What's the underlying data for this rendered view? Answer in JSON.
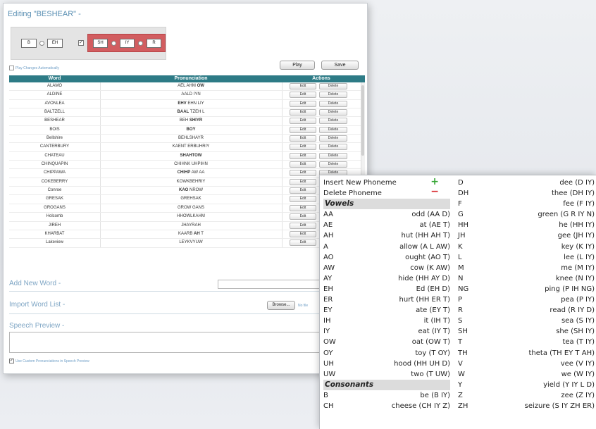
{
  "editor": {
    "title": "Editing \"BESHEAR\" -",
    "phoneme_group1": [
      "B",
      "EH"
    ],
    "phoneme_group2": [
      "SH",
      "IY",
      "R"
    ],
    "play_auto_label": "Play Changes Automatically",
    "play_button": "Play",
    "save_button": "Save",
    "table": {
      "headers": [
        "Word",
        "Pronunciation",
        "Actions"
      ],
      "edit_label": "Edit",
      "delete_label": "Delete",
      "rows": [
        {
          "word": "ALAMO",
          "pre": "AEL AHM ",
          "stress": "OW",
          "post": ""
        },
        {
          "word": "ALDINE",
          "pre": "AALD IYN",
          "stress": "",
          "post": ""
        },
        {
          "word": "AVONLEA",
          "pre": "",
          "stress": "EHV",
          "post": " EHN LIY"
        },
        {
          "word": "BALTZELL",
          "pre": "",
          "stress": "BAAL",
          "post": " TZEH L"
        },
        {
          "word": "BESHEAR",
          "pre": "BEH ",
          "stress": "SHIYR",
          "post": ""
        },
        {
          "word": "BOIS",
          "pre": "",
          "stress": "BOY",
          "post": ""
        },
        {
          "word": "Bellshire",
          "pre": "BEHLSHAYR",
          "stress": "",
          "post": ""
        },
        {
          "word": "CANTERBURY",
          "pre": "KAENT ERBUHRIY",
          "stress": "",
          "post": ""
        },
        {
          "word": "CHATEAU",
          "pre": "",
          "stress": "SHAHTOW",
          "post": ""
        },
        {
          "word": "CHINQUAPIN",
          "pre": "CHIHNK UHPIHN",
          "stress": "",
          "post": ""
        },
        {
          "word": "CHIPPAWA",
          "pre": "",
          "stress": "CHIHP",
          "post": " AW AA"
        },
        {
          "word": "COKEBERRY",
          "pre": "KOWKBEHRIY",
          "stress": "",
          "post": ""
        },
        {
          "word": "Conroe",
          "pre": "",
          "stress": "KAO",
          "post": " NROW"
        },
        {
          "word": "GRESAK",
          "pre": "GREHSAK",
          "stress": "",
          "post": ""
        },
        {
          "word": "GROGANS",
          "pre": "GROW GANS",
          "stress": "",
          "post": ""
        },
        {
          "word": "Holcomb",
          "pre": "HHOWLKAHM",
          "stress": "",
          "post": ""
        },
        {
          "word": "JIREH",
          "pre": "JHAYRAH",
          "stress": "",
          "post": ""
        },
        {
          "word": "KHARBAT",
          "pre": "KAARB ",
          "stress": "AH",
          "post": " T"
        },
        {
          "word": "Lakeview",
          "pre": "LEYKVYUW",
          "stress": "",
          "post": ""
        }
      ]
    },
    "add_new_word": "Add New Word -",
    "import_word_list": "Import Word List -",
    "browse_button": "Browse...",
    "no_file_text": "No file",
    "speech_preview": "Speech Preview -",
    "custom_pron_label": "Use Custom Pronunciations in Speech Preview"
  },
  "panel": {
    "insert_label": "Insert New Phoneme",
    "delete_label": "Delete Phoneme",
    "vowels_heading": "Vowels",
    "consonants_heading": "Consonants",
    "vowels": [
      {
        "code": "AA",
        "ex": "odd (AA D)"
      },
      {
        "code": "AE",
        "ex": "at (AE T)"
      },
      {
        "code": "AH",
        "ex": "hut (HH AH T)"
      },
      {
        "code": "A",
        "ex": "allow (A L AW)"
      },
      {
        "code": "AO",
        "ex": "ought (AO T)"
      },
      {
        "code": "AW",
        "ex": "cow (K AW)"
      },
      {
        "code": "AY",
        "ex": "hide (HH AY D)"
      },
      {
        "code": "EH",
        "ex": "Ed (EH D)"
      },
      {
        "code": "ER",
        "ex": "hurt (HH ER T)"
      },
      {
        "code": "EY",
        "ex": "ate (EY T)"
      },
      {
        "code": "IH",
        "ex": "it (IH T)"
      },
      {
        "code": "IY",
        "ex": "eat (IY T)"
      },
      {
        "code": "OW",
        "ex": "oat (OW T)"
      },
      {
        "code": "OY",
        "ex": "toy (T OY)"
      },
      {
        "code": "UH",
        "ex": "hood (HH UH D)"
      },
      {
        "code": "UW",
        "ex": "two (T UW)"
      }
    ],
    "consonants_left": [
      {
        "code": "B",
        "ex": "be (B IY)"
      },
      {
        "code": "CH",
        "ex": "cheese (CH IY Z)"
      }
    ],
    "consonants_right": [
      {
        "code": "D",
        "ex": "dee (D IY)"
      },
      {
        "code": "DH",
        "ex": "thee (DH IY)"
      },
      {
        "code": "F",
        "ex": "fee (F IY)"
      },
      {
        "code": "G",
        "ex": "green (G R IY N)"
      },
      {
        "code": "HH",
        "ex": "he (HH IY)"
      },
      {
        "code": "JH",
        "ex": "gee (JH IY)"
      },
      {
        "code": "K",
        "ex": "key (K IY)"
      },
      {
        "code": "L",
        "ex": "lee (L IY)"
      },
      {
        "code": "M",
        "ex": "me (M IY)"
      },
      {
        "code": "N",
        "ex": "knee (N IY)"
      },
      {
        "code": "NG",
        "ex": "ping (P IH NG)"
      },
      {
        "code": "P",
        "ex": "pea (P IY)"
      },
      {
        "code": "R",
        "ex": "read (R IY D)"
      },
      {
        "code": "S",
        "ex": "sea (S IY)"
      },
      {
        "code": "SH",
        "ex": "she (SH IY)"
      },
      {
        "code": "T",
        "ex": "tea (T IY)"
      },
      {
        "code": "TH",
        "ex": "theta (TH EY T AH)"
      },
      {
        "code": "V",
        "ex": "vee (V IY)"
      },
      {
        "code": "W",
        "ex": "we (W IY)"
      },
      {
        "code": "Y",
        "ex": "yield (Y IY L D)"
      },
      {
        "code": "Z",
        "ex": "zee (Z IY)"
      },
      {
        "code": "ZH",
        "ex": "seizure (S IY ZH ER)"
      }
    ]
  }
}
